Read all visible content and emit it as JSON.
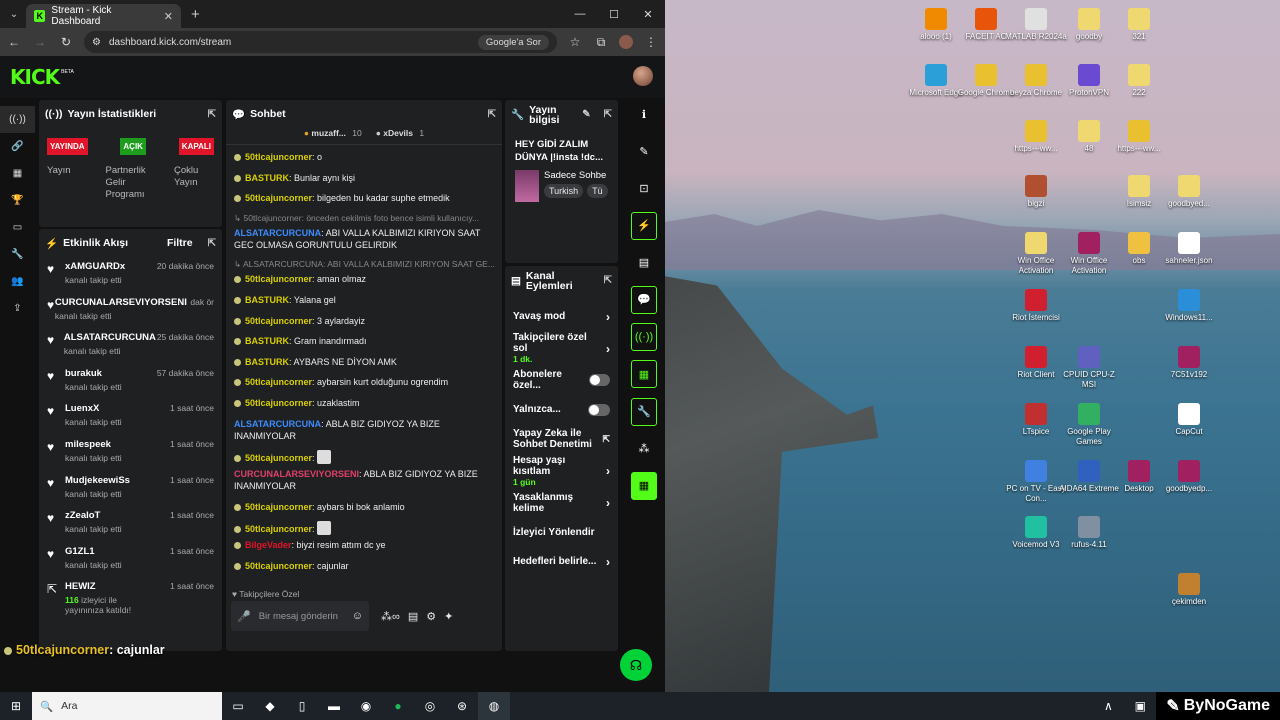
{
  "browser": {
    "tab_title": "Stream - Kick Dashboard",
    "url": "dashboard.kick.com/stream",
    "google_btn": "Google'a Sor"
  },
  "kick": {
    "logo": "KICK",
    "beta": "BETA"
  },
  "stats": {
    "title": "Yayın İstatistikleri",
    "badges": [
      {
        "label": "YAYINDA",
        "color": "#e0152a"
      },
      {
        "label": "AÇIK",
        "color": "#1e9c1e"
      },
      {
        "label": "KAPALI",
        "color": "#e0152a"
      }
    ],
    "cols": [
      "Yayın",
      "Partnerlik Gelir Programı",
      "Çoklu Yayın"
    ]
  },
  "feed": {
    "title": "Etkinlik Akışı",
    "filter": "Filtre",
    "items": [
      {
        "name": "xAMGUARDx",
        "sub": "kanalı takip etti",
        "time": "20 dakika önce"
      },
      {
        "name": "CURCUNALARSEVIYORSENI",
        "sub": "kanalı takip etti",
        "time": "dak ör"
      },
      {
        "name": "ALSATARCURCUNA",
        "sub": "kanalı takip etti",
        "time": "25 dakika önce"
      },
      {
        "name": "burakuk",
        "sub": "kanalı takip etti",
        "time": "57 dakika önce"
      },
      {
        "name": "LuenxX",
        "sub": "kanalı takip etti",
        "time": "1 saat önce"
      },
      {
        "name": "milespeek",
        "sub": "kanalı takip etti",
        "time": "1 saat önce"
      },
      {
        "name": "MudjekeewiSs",
        "sub": "kanalı takip etti",
        "time": "1 saat önce"
      },
      {
        "name": "zZealoT",
        "sub": "kanalı takip etti",
        "time": "1 saat önce"
      },
      {
        "name": "G1ZL1",
        "sub": "kanalı takip etti",
        "time": "1 saat önce"
      },
      {
        "name": "HEWIZ",
        "sub": "izleyici ile yayınınıza katıldı!",
        "time": "1 saat önce",
        "count": "116"
      }
    ]
  },
  "chat": {
    "title": "Sohbet",
    "top_users": [
      {
        "name": "muzaff...",
        "count": "10"
      },
      {
        "name": "xDevils",
        "count": "1"
      }
    ],
    "messages": [
      {
        "user": "50tlcajuncorner",
        "color": "#d8d000",
        "text": ": o",
        "dot": true
      },
      {
        "user": "BASTURK",
        "color": "#d8d000",
        "text": ": Bunlar aynı kişi",
        "dot": true
      },
      {
        "user": "50tlcajuncorner",
        "color": "#d8d000",
        "text": ": bilgeden bu kadar suphe etmedik",
        "dot": true
      },
      {
        "reply": "↳ 50tlcajuncorner: önceden cekilmis foto bence isimli kullanıcıy..."
      },
      {
        "user": "ALSATARCURCUNA",
        "color": "#3d8cff",
        "text": ": ABI VALLA KALBIMIZI KIRIYON SAAT GEC OLMASA GORUNTULU GELIRDIK",
        "dot": false
      },
      {
        "reply": "↳ ALSATARCURCUNA: ABI VALLA KALBIMIZI KIRIYON SAAT GE..."
      },
      {
        "user": "50tlcajuncorner",
        "color": "#d8d000",
        "text": ": aman olmaz",
        "dot": true
      },
      {
        "user": "BASTURK",
        "color": "#d8d000",
        "text": ": Yalana gel",
        "dot": true
      },
      {
        "user": "50tlcajuncorner",
        "color": "#d8d000",
        "text": ": 3 aylardayiz",
        "dot": true
      },
      {
        "user": "BASTURK",
        "color": "#d8d000",
        "text": ": Gram inandırmadı",
        "dot": true
      },
      {
        "user": "BASTURK",
        "color": "#d8d000",
        "text": ": AYBARS NE DİYON AMK",
        "dot": true
      },
      {
        "user": "50tlcajuncorner",
        "color": "#d8d000",
        "text": ": aybarsin kurt olduğunu ogrendim",
        "dot": true
      },
      {
        "user": "50tlcajuncorner",
        "color": "#d8d000",
        "text": ": uzaklastim",
        "dot": true
      },
      {
        "user": "ALSATARCURCUNA",
        "color": "#3d8cff",
        "text": ": ABLA BIZ GIDIYOZ YA BIZE INANMIYOLAR",
        "dot": false
      },
      {
        "user": "50tlcajuncorner",
        "color": "#d8d000",
        "text": ":",
        "dot": true,
        "emote": true
      },
      {
        "user": "CURCUNALARSEVIYORSENI",
        "color": "#e0406a",
        "text": ": ABLA BIZ GIDIYOZ YA BIZE INANMIYOLAR",
        "dot": false
      },
      {
        "user": "50tlcajuncorner",
        "color": "#d8d000",
        "text": ": aybars bi bok anlamio",
        "dot": true
      },
      {
        "user": "50tlcajuncorner",
        "color": "#d8d000",
        "text": ":",
        "dot": true,
        "emote": true
      },
      {
        "user": "BilgeVader",
        "color": "#e0152a",
        "text": ": biyzi resim attım dc ye",
        "dot": true
      },
      {
        "user": "50tlcajuncorner",
        "color": "#d8d000",
        "text": ": cajunlar",
        "dot": true
      }
    ],
    "follower_only": "Takipçilere Özel",
    "input_placeholder": "Bir mesaj gönderin",
    "overlay_user": "50tlcajuncorner",
    "overlay_msg": ": cajunlar"
  },
  "stream_info": {
    "title": "Yayın bilgisi",
    "stream_title": "HEY GİDİ ZALIM DÜNYA |!insta !dc...",
    "category": "Sadece Sohbe",
    "tags": [
      "Turkish",
      "Tü"
    ]
  },
  "actions": {
    "title": "Kanal Eylemleri",
    "items": [
      {
        "label": "Yavaş mod",
        "type": "arrow"
      },
      {
        "label": "Takipçilere özel sol",
        "sub": "1 dk.",
        "type": "arrow"
      },
      {
        "label": "Abonelere özel...",
        "type": "toggle"
      },
      {
        "label": "Yalnızca...",
        "type": "toggle"
      },
      {
        "label": "Yapay Zeka ile Sohbet Denetimi",
        "type": "link"
      },
      {
        "label": "Hesap yaşı kısıtlam",
        "sub": "1 gün",
        "type": "arrow"
      },
      {
        "label": "Yasaklanmış kelime",
        "type": "arrow"
      },
      {
        "label": "İzleyici Yönlendir",
        "type": "none"
      },
      {
        "label": "Hedefleri belirle...",
        "type": "arrow"
      }
    ]
  },
  "desktop_icons": [
    {
      "label": "alooo (1)",
      "color": "#f08a00"
    },
    {
      "label": "FACEIT AC",
      "color": "#e8540a"
    },
    {
      "label": "MATLAB R2024a",
      "color": "#e0e0e0"
    },
    {
      "label": "goodby",
      "color": "#f0d870"
    },
    {
      "label": "321",
      "color": "#f0d870"
    },
    {
      "label": "Microsoft Edge",
      "color": "#2a9fd8"
    },
    {
      "label": "Google Chrome",
      "color": "#e8c030"
    },
    {
      "label": "beyza Chrome",
      "color": "#e8c030"
    },
    {
      "label": "ProtonVPN",
      "color": "#6a4ad0"
    },
    {
      "label": "222",
      "color": "#f0d870"
    },
    {
      "label": "https---ww...",
      "color": "#e8c030"
    },
    {
      "label": "48",
      "color": "#f0d870"
    },
    {
      "label": "https---ww...",
      "color": "#e8c030"
    },
    {
      "label": "bigzi",
      "color": "#b05030"
    },
    {
      "label": "İsimsiz",
      "color": "#f0d870"
    },
    {
      "label": "goodbyed...",
      "color": "#f0d870"
    },
    {
      "label": "Win Office Activation",
      "color": "#f0d870"
    },
    {
      "label": "Win Office Activation",
      "color": "#a02060"
    },
    {
      "label": "obs",
      "color": "#f0c040"
    },
    {
      "label": "sahneler.json",
      "color": "#ffffff"
    },
    {
      "label": "Riot İstemcisi",
      "color": "#d02030"
    },
    {
      "label": "Windows11...",
      "color": "#2a8fd8"
    },
    {
      "label": "Riot Client",
      "color": "#d02030"
    },
    {
      "label": "CPUID CPU-Z MSI",
      "color": "#6060c0"
    },
    {
      "label": "7C51v192",
      "color": "#a02060"
    },
    {
      "label": "LTspice",
      "color": "#c03030"
    },
    {
      "label": "Google Play Games",
      "color": "#30b060"
    },
    {
      "label": "CapCut",
      "color": "#ffffff"
    },
    {
      "label": "PC on TV - Easy Con...",
      "color": "#4080e0"
    },
    {
      "label": "AIDA64 Extreme",
      "color": "#3060c0"
    },
    {
      "label": "Desktop",
      "color": "#a02060"
    },
    {
      "label": "goodbyedp...",
      "color": "#a02060"
    },
    {
      "label": "Voicemod V3",
      "color": "#20c0a0"
    },
    {
      "label": "rufus-4.11",
      "color": "#8090a0"
    },
    {
      "label": "çekimden",
      "color": "#c08030"
    }
  ],
  "taskbar": {
    "search": "Ara",
    "watermark": "ByNoGame"
  }
}
